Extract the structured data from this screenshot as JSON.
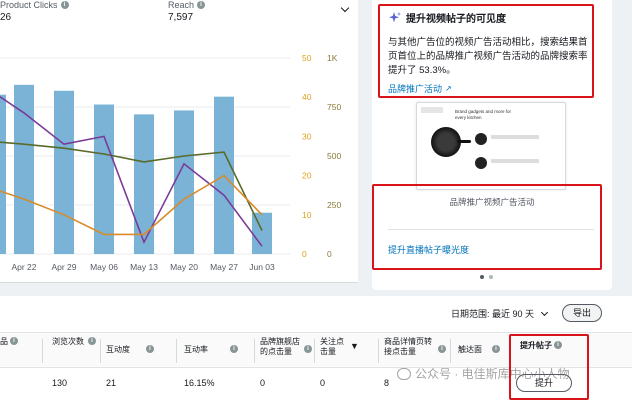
{
  "metrics": [
    {
      "label": "Product Clicks",
      "value": "26"
    },
    {
      "label": "Reach",
      "value": "7,597"
    }
  ],
  "chart_data": {
    "type": "bar",
    "categories": [
      "Apr 22",
      "Apr 29",
      "May 06",
      "May 13",
      "May 20",
      "May 27",
      "Jun 03"
    ],
    "bars": [
      8600,
      8300,
      7600,
      7100,
      7300,
      8000,
      2100
    ],
    "axes": {
      "right1": {
        "ticks": [
          "50",
          "40",
          "30",
          "20",
          "10",
          "0"
        ],
        "range": [
          0,
          50
        ],
        "color": "#e0a220"
      },
      "right2": {
        "ticks": [
          "1K",
          "750",
          "500",
          "250",
          "0"
        ],
        "range": [
          0,
          1000
        ],
        "color": "#8a7a3a"
      },
      "y_hidden_bars": [
        0,
        12000
      ]
    },
    "lines": [
      {
        "color": "#5a6b2a",
        "values": [
          560,
          540,
          510,
          470,
          500,
          520,
          120
        ],
        "axis": "right2"
      },
      {
        "color": "#7a3a9a",
        "values": [
          36,
          28,
          30,
          3,
          23,
          15,
          2
        ],
        "axis": "right1"
      },
      {
        "color": "#d98b2a",
        "values": [
          14,
          10,
          5,
          5,
          14,
          20,
          10
        ],
        "axis": "right1"
      }
    ]
  },
  "side_card": {
    "title": "提升视频帖子的可见度",
    "body": "与其他广告位的视频广告活动相比，搜索结果首页首位上的品牌推广视频广告活动的品牌搜索率提升了 53.3%。",
    "link": "品牌推广活动",
    "preview_title": "Brand gadgets and more for every kitchen",
    "preview_caption": "品牌推广视频广告活动",
    "link2": "提升直播帖子曝光度"
  },
  "table": {
    "date_range_label": "日期范围: 最近 90 天",
    "export": "导出",
    "headers": [
      "品",
      "浏览次数",
      "互动度",
      "互动率",
      "品牌旗舰店的点击量",
      "关注点击量",
      "商品详情页转接点击量",
      "触达面",
      "提升帖子"
    ],
    "row": [
      "",
      "130",
      "21",
      "16.15%",
      "0",
      "0",
      "8",
      "",
      ""
    ],
    "boost_button": "提升"
  },
  "watermark": "公众号 · 电佳斯库中心小人物"
}
